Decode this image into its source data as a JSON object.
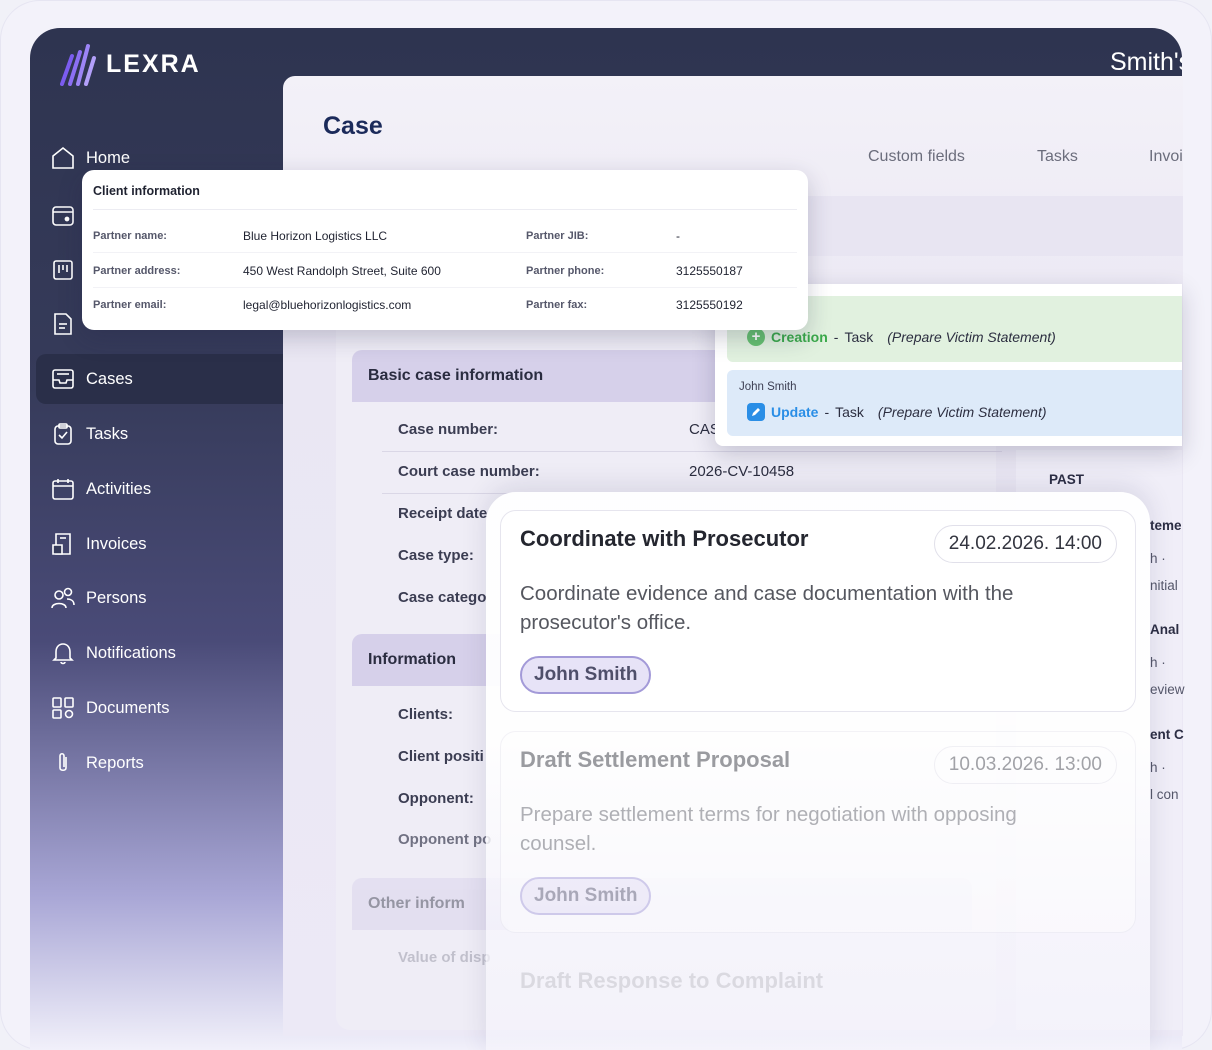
{
  "brand": {
    "name": "LEXRA"
  },
  "header": {
    "user_partial": "Smith's"
  },
  "sidebar": {
    "items": [
      {
        "label": "Home",
        "icon": "home-icon"
      },
      {
        "label": "",
        "icon": "calendar-icon"
      },
      {
        "label": "",
        "icon": "board-icon"
      },
      {
        "label": "",
        "icon": "document-icon"
      },
      {
        "label": "Cases",
        "icon": "inbox-icon",
        "active": true
      },
      {
        "label": "Tasks",
        "icon": "clipboard-check-icon"
      },
      {
        "label": "Activities",
        "icon": "calendar-icon"
      },
      {
        "label": "Invoices",
        "icon": "invoice-icon"
      },
      {
        "label": "Persons",
        "icon": "persons-icon"
      },
      {
        "label": "Notifications",
        "icon": "bell-icon"
      },
      {
        "label": "Documents",
        "icon": "documents-icon"
      },
      {
        "label": "Reports",
        "icon": "paperclip-icon"
      }
    ]
  },
  "main": {
    "title": "Case",
    "tabs": [
      "Custom fields",
      "Tasks",
      "Invoi"
    ]
  },
  "client_info": {
    "title": "Client information",
    "fields": [
      {
        "label": "Partner name:",
        "value": "Blue Horizon Logistics LLC"
      },
      {
        "label": "Partner JIB:",
        "value": "-"
      },
      {
        "label": "Partner address:",
        "value": "450 West Randolph Street, Suite 600"
      },
      {
        "label": "Partner phone:",
        "value": "3125550187"
      },
      {
        "label": "Partner email:",
        "value": "legal@bluehorizonlogistics.com"
      },
      {
        "label": "Partner fax:",
        "value": "3125550192"
      }
    ]
  },
  "case_info": {
    "section1_title": "Basic case information",
    "rows": [
      {
        "label": "Case number:",
        "value": "CAS"
      },
      {
        "label": "Court case number:",
        "value": "2026-CV-10458"
      },
      {
        "label": "Receipt date",
        "value": ""
      },
      {
        "label": "Case type:",
        "value": ""
      },
      {
        "label": "Case catego",
        "value": ""
      }
    ],
    "section2_title": "Information",
    "rows2": [
      {
        "label": "Clients:"
      },
      {
        "label": "Client positi"
      },
      {
        "label": "Opponent:"
      },
      {
        "label": "Opponent po"
      }
    ],
    "section3_title": "Other inform",
    "rows3": [
      {
        "label": "Value of disp"
      }
    ]
  },
  "activities": [
    {
      "author": "",
      "verb": "Creation",
      "type": "Task",
      "subject": "(Prepare Victim Statement)",
      "color": "#3aa94a"
    },
    {
      "author": "John Smith",
      "verb": "Update",
      "type": "Task",
      "subject": "(Prepare Victim Statement)",
      "color": "#2a8ee6"
    }
  ],
  "right_panel": {
    "past_label": "PAST",
    "fragments": [
      "teme",
      "h  ·",
      "nitial",
      "Anal",
      "h  ·",
      "eview",
      "ent C",
      "h  ·",
      "l con"
    ]
  },
  "tasks": [
    {
      "title": "Coordinate with Prosecutor",
      "date": "24.02.2026. 14:00",
      "description": "Coordinate evidence and case documentation with the prosecutor's office.",
      "assignee": "John Smith"
    },
    {
      "title": "Draft Settlement Proposal",
      "date": "10.03.2026. 13:00",
      "description": "Prepare settlement terms for negotiation with opposing counsel.",
      "assignee": "John Smith"
    },
    {
      "title": "Draft Response to Complaint",
      "date": "",
      "description": "",
      "assignee": ""
    }
  ],
  "colors": {
    "sidebar_bg": "#2e3450",
    "accent_purple": "#7b5cf0",
    "title_blue": "#1b2a5a",
    "creation_green": "#3aa94a",
    "update_blue": "#2a8ee6",
    "pill_border": "#a39ad8"
  }
}
